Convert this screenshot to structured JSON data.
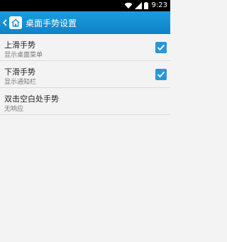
{
  "status_bar": {
    "time": "9:23",
    "icons": [
      "wifi-icon",
      "signal-icon",
      "battery-icon"
    ]
  },
  "action_bar": {
    "title": "桌面手势设置",
    "back_icon": "chevron-left-icon",
    "app_icon": "home-icon",
    "accent_color": "#1a93d6"
  },
  "settings": [
    {
      "title": "上滑手势",
      "summary": "显示桌面菜单",
      "checked": true
    },
    {
      "title": "下滑手势",
      "summary": "显示通知栏",
      "checked": true
    },
    {
      "title": "双击空白处手势",
      "summary": "无响应",
      "checked": false
    }
  ],
  "checkbox_color": "#2a96d9"
}
